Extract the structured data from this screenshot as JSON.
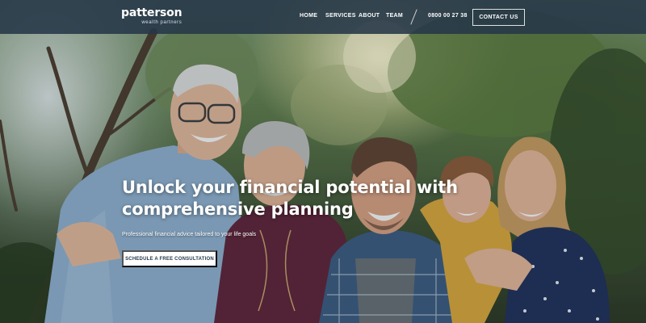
{
  "brand": {
    "name": "patterson",
    "tagline": "wealth partners"
  },
  "nav": {
    "links": [
      "HOME",
      "SERVICES",
      "ABOUT",
      "TEAM"
    ],
    "phone": "0800 00 27 38",
    "contact_label": "CONTACT US"
  },
  "hero": {
    "headline_line1": "Unlock your financial potential with",
    "headline_line2": "comprehensive planning",
    "subtitle": "Professional financial advice tailored to your life goals",
    "cta_label": "SCHEDULE A FREE CONSULTATION",
    "image_subject": "family-group-photo"
  },
  "colors": {
    "nav_bg": "#263748",
    "text": "#ffffff",
    "cta_text": "#26384a"
  }
}
